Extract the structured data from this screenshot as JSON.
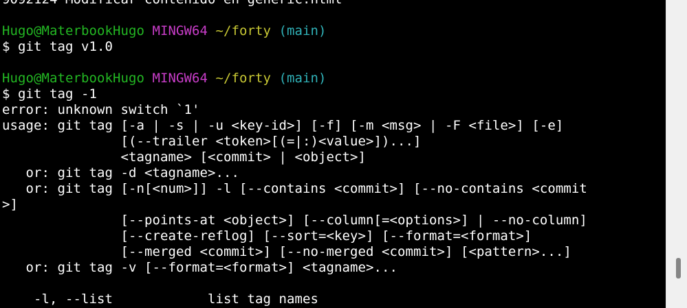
{
  "terminal": {
    "lines": [
      {
        "segments": [
          {
            "text": "9092124 Modificar contenido en generic.html",
            "color": "white"
          }
        ]
      },
      {
        "segments": []
      },
      {
        "segments": [
          {
            "text": "Hugo@MaterbookHugo",
            "color": "green"
          },
          {
            "text": " ",
            "color": "white"
          },
          {
            "text": "MINGW64",
            "color": "magenta"
          },
          {
            "text": " ",
            "color": "white"
          },
          {
            "text": "~/forty",
            "color": "yellow"
          },
          {
            "text": " ",
            "color": "white"
          },
          {
            "text": "(main)",
            "color": "cyan"
          }
        ]
      },
      {
        "segments": [
          {
            "text": "$ git tag v1.0",
            "color": "white"
          }
        ]
      },
      {
        "segments": []
      },
      {
        "segments": [
          {
            "text": "Hugo@MaterbookHugo",
            "color": "green"
          },
          {
            "text": " ",
            "color": "white"
          },
          {
            "text": "MINGW64",
            "color": "magenta"
          },
          {
            "text": " ",
            "color": "white"
          },
          {
            "text": "~/forty",
            "color": "yellow"
          },
          {
            "text": " ",
            "color": "white"
          },
          {
            "text": "(main)",
            "color": "cyan"
          }
        ]
      },
      {
        "segments": [
          {
            "text": "$ git tag -1",
            "color": "white"
          }
        ]
      },
      {
        "segments": [
          {
            "text": "error: unknown switch `1'",
            "color": "white"
          }
        ]
      },
      {
        "segments": [
          {
            "text": "usage: git tag [-a | -s | -u <key-id>] [-f] [-m <msg> | -F <file>] [-e]",
            "color": "white"
          }
        ]
      },
      {
        "segments": [
          {
            "text": "               [(--trailer <token>[(=|:)<value>])...]",
            "color": "white"
          }
        ]
      },
      {
        "segments": [
          {
            "text": "               <tagname> [<commit> | <object>]",
            "color": "white"
          }
        ]
      },
      {
        "segments": [
          {
            "text": "   or: git tag -d <tagname>...",
            "color": "white"
          }
        ]
      },
      {
        "segments": [
          {
            "text": "   or: git tag [-n[<num>]] -l [--contains <commit>] [--no-contains <commit",
            "color": "white"
          }
        ]
      },
      {
        "segments": [
          {
            "text": ">]",
            "color": "white"
          }
        ]
      },
      {
        "segments": [
          {
            "text": "               [--points-at <object>] [--column[=<options>] | --no-column]",
            "color": "white"
          }
        ]
      },
      {
        "segments": [
          {
            "text": "               [--create-reflog] [--sort=<key>] [--format=<format>]",
            "color": "white"
          }
        ]
      },
      {
        "segments": [
          {
            "text": "               [--merged <commit>] [--no-merged <commit>] [<pattern>...]",
            "color": "white"
          }
        ]
      },
      {
        "segments": [
          {
            "text": "   or: git tag -v [--format=<format>] <tagname>...",
            "color": "white"
          }
        ]
      },
      {
        "segments": []
      },
      {
        "segments": [
          {
            "text": "    -l, --list            list tag names",
            "color": "white"
          }
        ]
      }
    ]
  },
  "colors": {
    "background": "#000000",
    "text": "#ffffff",
    "user_host": "#23b823",
    "mingw": "#c83dc8",
    "path": "#c8c834",
    "branch": "#30b2b8",
    "scrollbar_track": "#f0f0f0",
    "scrollbar_thumb": "#858585"
  },
  "scrollbar": {
    "position_fraction": 0.92
  }
}
